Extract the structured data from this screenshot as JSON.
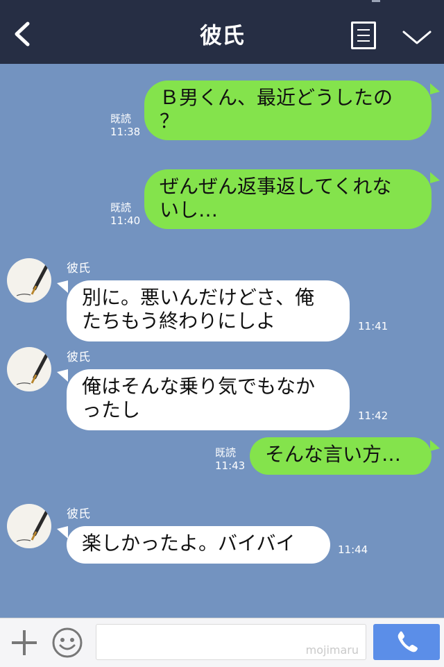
{
  "header": {
    "title": "彼氏",
    "back_icon": "chevron-left-icon",
    "menu_icon": "list-icon",
    "collapse_icon": "chevron-down-icon"
  },
  "messages": [
    {
      "side": "me",
      "lines": [
        "Ｂ男くん、最近どうしたの",
        "？"
      ],
      "read": "既読",
      "time": "11:38"
    },
    {
      "side": "me",
      "lines": [
        "ぜんぜん返事返してくれな",
        "いし…"
      ],
      "read": "既読",
      "time": "11:40"
    },
    {
      "side": "them",
      "sender": "彼氏",
      "lines": [
        "別に。悪いんだけどさ、俺",
        "たちもう終わりにしよ"
      ],
      "time": "11:41"
    },
    {
      "side": "them",
      "sender": "彼氏",
      "lines": [
        "俺はそんな乗り気でもなか",
        "ったし"
      ],
      "time": "11:42"
    },
    {
      "side": "me",
      "lines": [
        "そんな言い方…"
      ],
      "read": "既読",
      "time": "11:43"
    },
    {
      "side": "them",
      "sender": "彼氏",
      "lines": [
        "楽しかったよ。バイバイ"
      ],
      "time": "11:44"
    }
  ],
  "footer": {
    "input_value": "",
    "watermark": "mojimaru",
    "plus_icon": "plus-icon",
    "emoji_icon": "smiley-icon",
    "call_icon": "phone-icon"
  },
  "colors": {
    "background": "#7393c0",
    "header": "#262e44",
    "my_bubble": "#84e34c",
    "their_bubble": "#ffffff",
    "call_button": "#5b8ee8"
  }
}
